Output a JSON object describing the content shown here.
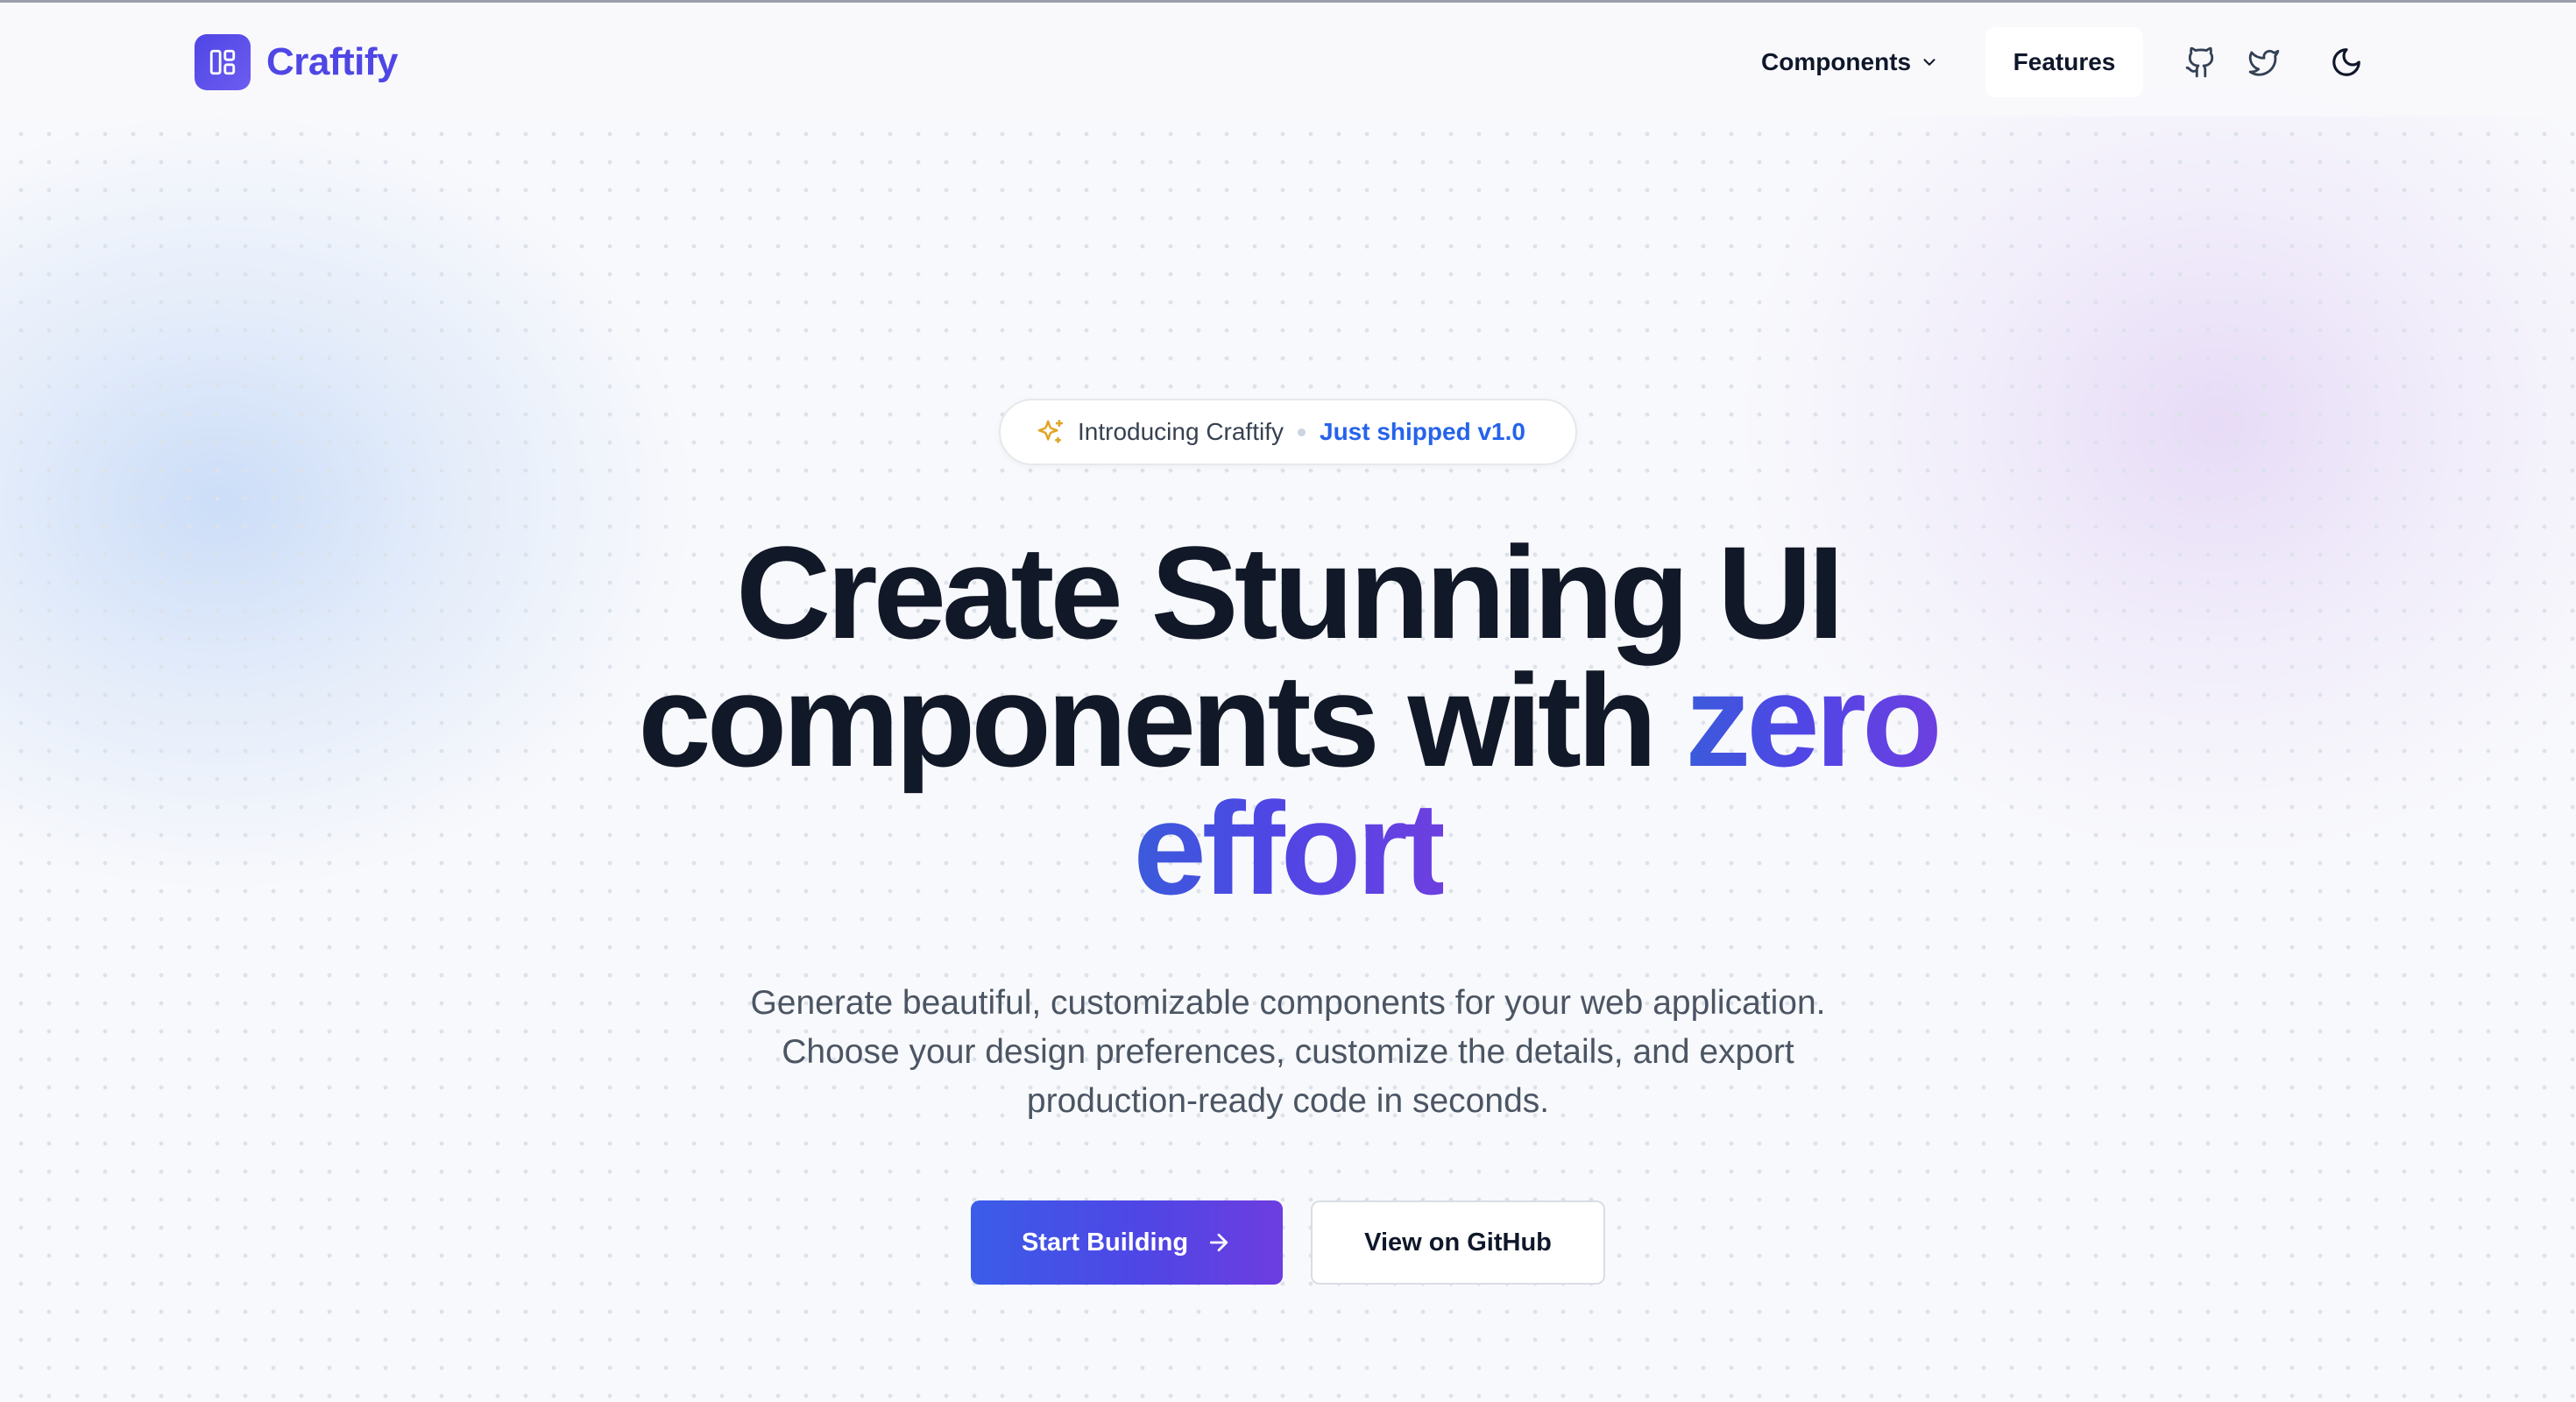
{
  "brand": {
    "name": "Craftify",
    "logo_icon": "layout-dashboard-icon",
    "accent_color": "#4f46e5"
  },
  "nav": {
    "components_label": "Components",
    "components_icon": "chevron-down-icon",
    "features_label": "Features",
    "icons": [
      "github-icon",
      "twitter-icon",
      "moon-icon"
    ]
  },
  "hero": {
    "badge": {
      "icon": "sparkles-icon",
      "intro": "Introducing Craftify",
      "shipped": "Just shipped v1.0"
    },
    "headline_line1": "Create Stunning UI",
    "headline_line2_plain": "components with",
    "headline_line2_accent": "zero",
    "headline_line3_accent": "effort",
    "subtext_line1": "Generate beautiful, customizable components for your web application.",
    "subtext_line2": "Choose your design preferences, customize the details, and export",
    "subtext_line3": "production-ready code in seconds.",
    "primary_cta": "Start Building",
    "primary_cta_icon": "arrow-right-icon",
    "secondary_cta": "View on GitHub"
  }
}
